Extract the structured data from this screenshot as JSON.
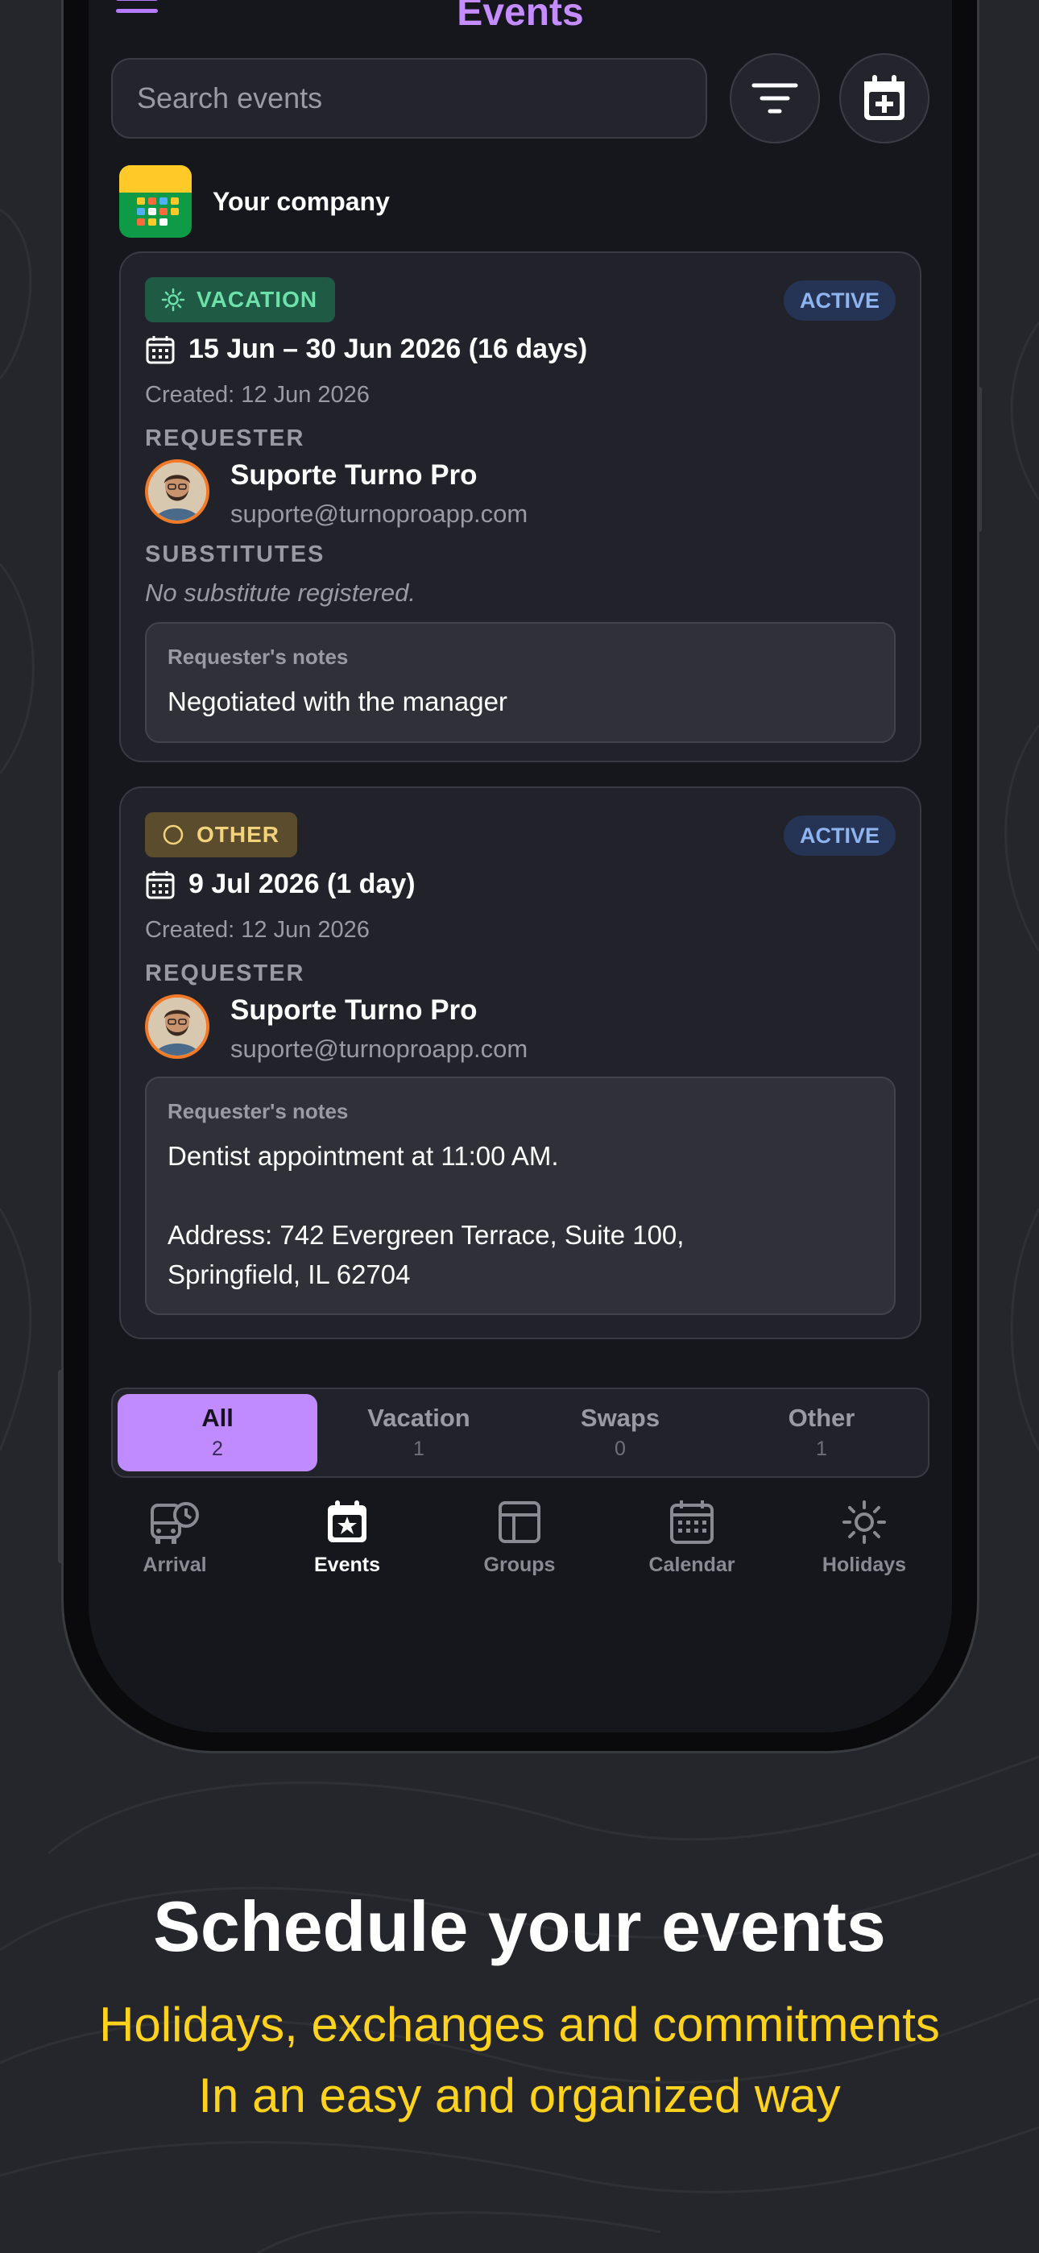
{
  "header": {
    "title": "Events"
  },
  "search": {
    "placeholder": "Search events"
  },
  "company": {
    "name": "Your company"
  },
  "events": [
    {
      "type": "VACATION",
      "status": "ACTIVE",
      "dates": "15 Jun – 30 Jun 2026 (16 days)",
      "created": "Created: 12 Jun 2026",
      "requester_label": "REQUESTER",
      "requester_name": "Suporte Turno Pro",
      "requester_email": "suporte@turnoproapp.com",
      "substitutes_label": "SUBSTITUTES",
      "substitutes_text": "No substitute registered.",
      "notes_label": "Requester's notes",
      "notes": "Negotiated with the manager"
    },
    {
      "type": "OTHER",
      "status": "ACTIVE",
      "dates": "9 Jul 2026 (1 day)",
      "created": "Created: 12 Jun 2026",
      "requester_label": "REQUESTER",
      "requester_name": "Suporte Turno Pro",
      "requester_email": "suporte@turnoproapp.com",
      "notes_label": "Requester's notes",
      "notes": "Dentist appointment at 11:00 AM.\n\nAddress: 742 Evergreen Terrace, Suite 100,\nSpringfield, IL 62704"
    }
  ],
  "filters": [
    {
      "label": "All",
      "count": "2",
      "selected": true
    },
    {
      "label": "Vacation",
      "count": "1"
    },
    {
      "label": "Swaps",
      "count": "0"
    },
    {
      "label": "Other",
      "count": "1"
    }
  ],
  "tabs": [
    {
      "label": "Arrival",
      "icon": "bus-clock-icon"
    },
    {
      "label": "Events",
      "icon": "calendar-star-icon",
      "active": true
    },
    {
      "label": "Groups",
      "icon": "grid-icon"
    },
    {
      "label": "Calendar",
      "icon": "calendar-icon"
    },
    {
      "label": "Holidays",
      "icon": "sun-icon"
    }
  ],
  "promo": {
    "headline": "Schedule your events",
    "line1": "Holidays, exchanges and commitments",
    "line2": "In an easy and organized way"
  },
  "colors": {
    "accent": "#c08bff",
    "vacation_tag_bg": "#1f5a45",
    "vacation_tag_fg": "#6ee0aa",
    "other_tag_bg": "#5a4c2c",
    "other_tag_fg": "#f2d27a",
    "status_bg": "#253454",
    "promo_yellow": "#ffd21e"
  }
}
